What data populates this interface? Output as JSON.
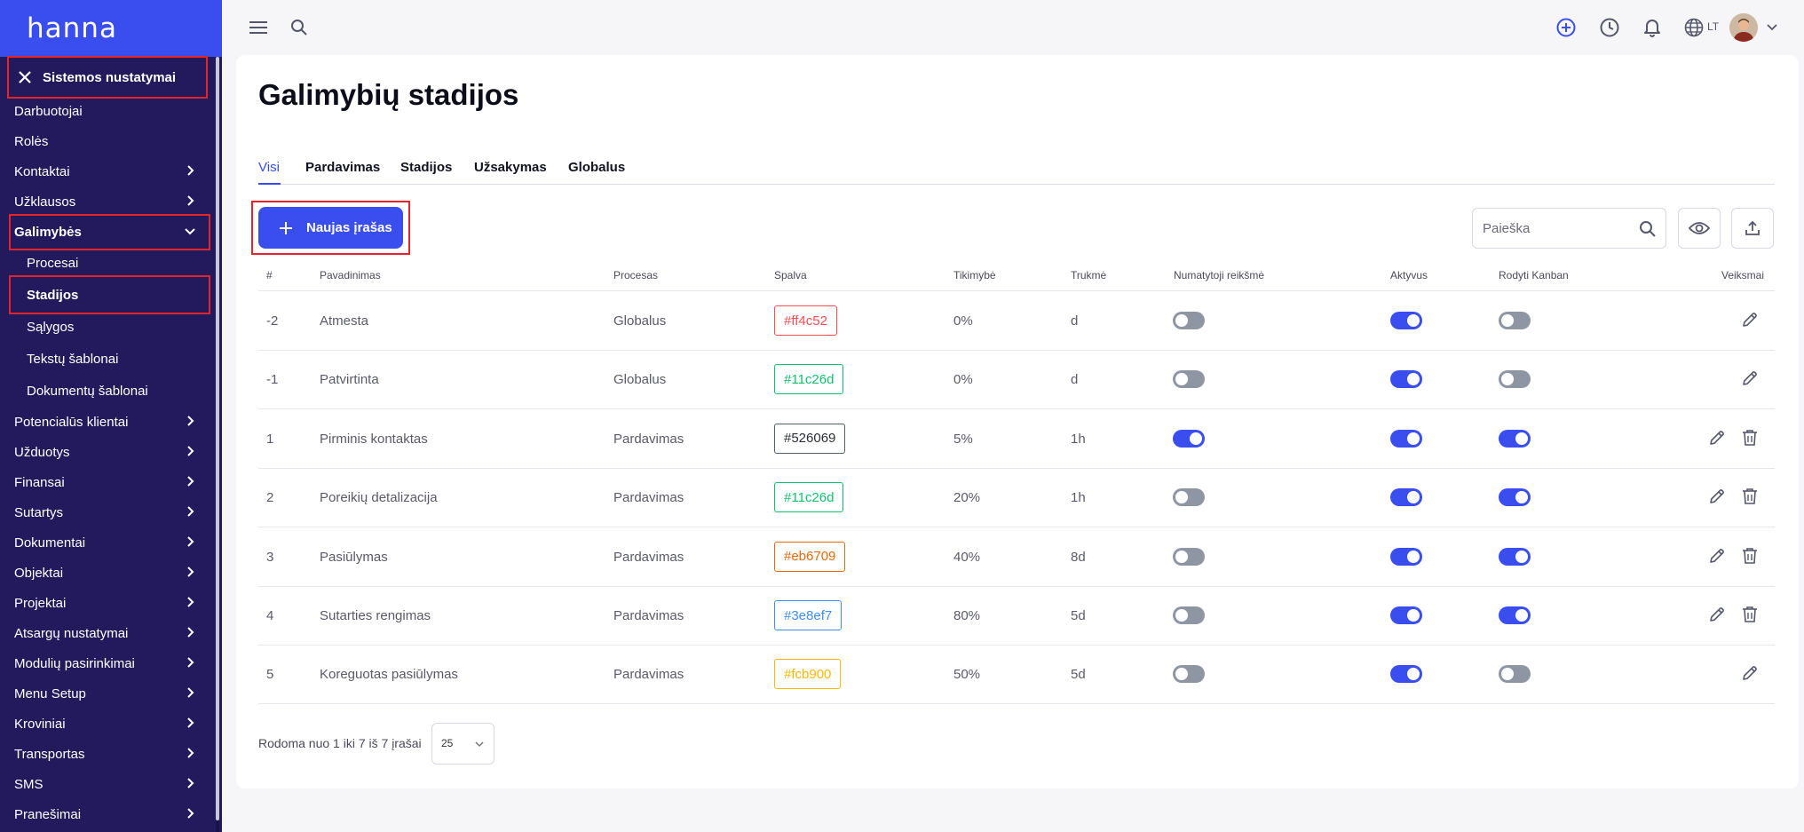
{
  "app": {
    "logo": "hanna"
  },
  "sidebar": {
    "header_label": "Sistemos nustatymai",
    "items": [
      {
        "label": "Darbuotojai",
        "chevron": false,
        "sub": false,
        "bold": false
      },
      {
        "label": "Rolės",
        "chevron": false,
        "sub": false,
        "bold": false
      },
      {
        "label": "Kontaktai",
        "chevron": true,
        "sub": false,
        "bold": false
      },
      {
        "label": "Užklausos",
        "chevron": true,
        "sub": false,
        "bold": false
      },
      {
        "label": "Galimybės",
        "chevron": "down",
        "sub": false,
        "bold": true
      },
      {
        "label": "Procesai",
        "chevron": false,
        "sub": true,
        "bold": false
      },
      {
        "label": "Stadijos",
        "chevron": false,
        "sub": true,
        "bold": true
      },
      {
        "label": "Sąlygos",
        "chevron": false,
        "sub": true,
        "bold": false
      },
      {
        "label": "Tekstų šablonai",
        "chevron": false,
        "sub": true,
        "bold": false
      },
      {
        "label": "Dokumentų šablonai",
        "chevron": false,
        "sub": true,
        "bold": false
      },
      {
        "label": "Potencialūs klientai",
        "chevron": true,
        "sub": false,
        "bold": false
      },
      {
        "label": "Užduotys",
        "chevron": true,
        "sub": false,
        "bold": false
      },
      {
        "label": "Finansai",
        "chevron": true,
        "sub": false,
        "bold": false
      },
      {
        "label": "Sutartys",
        "chevron": true,
        "sub": false,
        "bold": false
      },
      {
        "label": "Dokumentai",
        "chevron": true,
        "sub": false,
        "bold": false
      },
      {
        "label": "Objektai",
        "chevron": true,
        "sub": false,
        "bold": false
      },
      {
        "label": "Projektai",
        "chevron": true,
        "sub": false,
        "bold": false
      },
      {
        "label": "Atsargų nustatymai",
        "chevron": true,
        "sub": false,
        "bold": false
      },
      {
        "label": "Modulių pasirinkimai",
        "chevron": true,
        "sub": false,
        "bold": false
      },
      {
        "label": "Menu Setup",
        "chevron": true,
        "sub": false,
        "bold": false
      },
      {
        "label": "Kroviniai",
        "chevron": true,
        "sub": false,
        "bold": false
      },
      {
        "label": "Transportas",
        "chevron": true,
        "sub": false,
        "bold": false
      },
      {
        "label": "SMS",
        "chevron": true,
        "sub": false,
        "bold": false
      },
      {
        "label": "Pranešimai",
        "chevron": true,
        "sub": false,
        "bold": false
      }
    ]
  },
  "topbar": {
    "language": "LT"
  },
  "page": {
    "title": "Galimybių stadijos",
    "tabs": [
      {
        "label": "Visi",
        "active": true
      },
      {
        "label": "Pardavimas",
        "active": false
      },
      {
        "label": "Stadijos",
        "active": false
      },
      {
        "label": "Užsakymas",
        "active": false
      },
      {
        "label": "Globalus",
        "active": false
      }
    ],
    "add_button_label": "Naujas įrašas",
    "search_placeholder": "Paieška"
  },
  "table": {
    "columns": [
      "#",
      "Pavadinimas",
      "Procesas",
      "Spalva",
      "Tikimybė",
      "Trukmė",
      "Numatytoji reikšmė",
      "Aktyvus",
      "Rodyti Kanban",
      "Veiksmai"
    ],
    "rows": [
      {
        "num": "-2",
        "name": "Atmesta",
        "process": "Globalus",
        "color": "#ff4c52",
        "chip_color": "#ff4c52",
        "probability": "0%",
        "duration": "d",
        "default": false,
        "active": true,
        "kanban": false,
        "deletable": false
      },
      {
        "num": "-1",
        "name": "Patvirtinta",
        "process": "Globalus",
        "color": "#11c26d",
        "chip_color": "#11c26d",
        "probability": "0%",
        "duration": "d",
        "default": false,
        "active": true,
        "kanban": false,
        "deletable": false
      },
      {
        "num": "1",
        "name": "Pirminis kontaktas",
        "process": "Pardavimas",
        "color": "#526069",
        "chip_color": "#526069",
        "probability": "5%",
        "duration": "1h",
        "default": true,
        "active": true,
        "kanban": true,
        "deletable": true
      },
      {
        "num": "2",
        "name": "Poreikių detalizacija",
        "process": "Pardavimas",
        "color": "#11c26d",
        "chip_color": "#11c26d",
        "probability": "20%",
        "duration": "1h",
        "default": false,
        "active": true,
        "kanban": true,
        "deletable": true
      },
      {
        "num": "3",
        "name": "Pasiūlymas",
        "process": "Pardavimas",
        "color": "#eb6709",
        "chip_color": "#eb6709",
        "probability": "40%",
        "duration": "8d",
        "default": false,
        "active": true,
        "kanban": true,
        "deletable": true
      },
      {
        "num": "4",
        "name": "Sutarties rengimas",
        "process": "Pardavimas",
        "color": "#3e8ef7",
        "chip_color": "#3e8ef7",
        "probability": "80%",
        "duration": "5d",
        "default": false,
        "active": true,
        "kanban": true,
        "deletable": true
      },
      {
        "num": "5",
        "name": "Koreguotas pasiūlymas",
        "process": "Pardavimas",
        "color": "#fcb900",
        "chip_color": "#fcb900",
        "probability": "50%",
        "duration": "5d",
        "default": false,
        "active": true,
        "kanban": false,
        "deletable": false
      }
    ]
  },
  "footer": {
    "summary": "Rodoma nuo 1 iki 7 iš 7 įrašai",
    "page_size": "25"
  }
}
